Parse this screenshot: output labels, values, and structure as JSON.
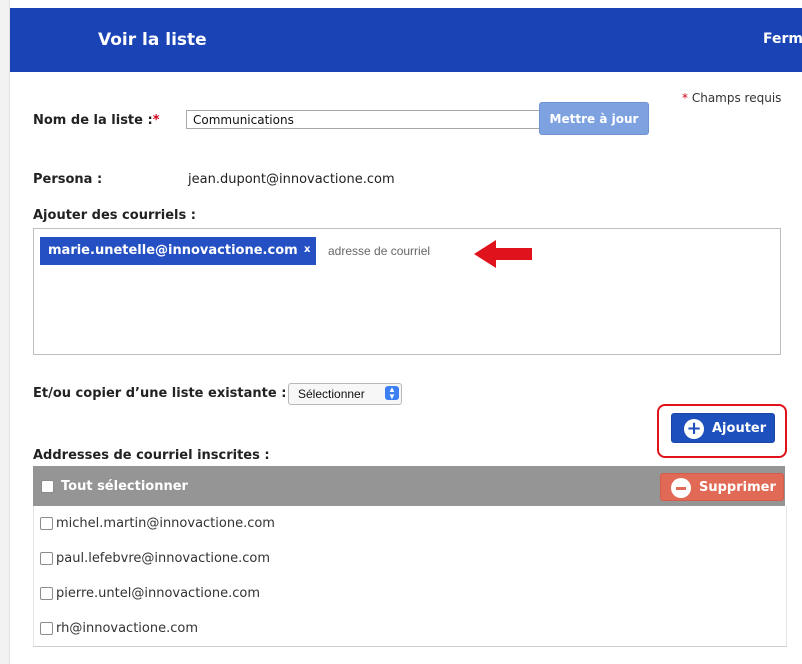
{
  "header": {
    "title": "Voir la liste",
    "close_label": "Fermer"
  },
  "form": {
    "required_note": "Champs requis",
    "list_name_label": "Nom de la liste :",
    "list_name_value": "Communications",
    "update_button": "Mettre à jour",
    "persona_label": "Persona :",
    "persona_value": "jean.dupont@innovactione.com",
    "add_emails_label": "Ajouter des courriels :",
    "email_chip": "marie.unetelle@innovactione.com",
    "email_chip_remove": "x",
    "email_placeholder": "adresse de courriel",
    "copy_label": "Et/ou copier d’une liste existante :",
    "copy_select_value": "Sélectionner",
    "add_button": "Ajouter",
    "subscribed_label": "Addresses de courriel inscrites :"
  },
  "table": {
    "select_all_label": "Tout sélectionner",
    "delete_button": "Supprimer",
    "rows": [
      "michel.martin@innovactione.com",
      "paul.lefebvre@innovactione.com",
      "pierre.untel@innovactione.com",
      "rh@innovactione.com"
    ]
  },
  "colors": {
    "header_bg": "#1a44b5",
    "chip_bg": "#2450c3",
    "add_button_bg": "#1d4fbd",
    "delete_button_bg": "#e06a56",
    "highlight": "#e0121b"
  }
}
